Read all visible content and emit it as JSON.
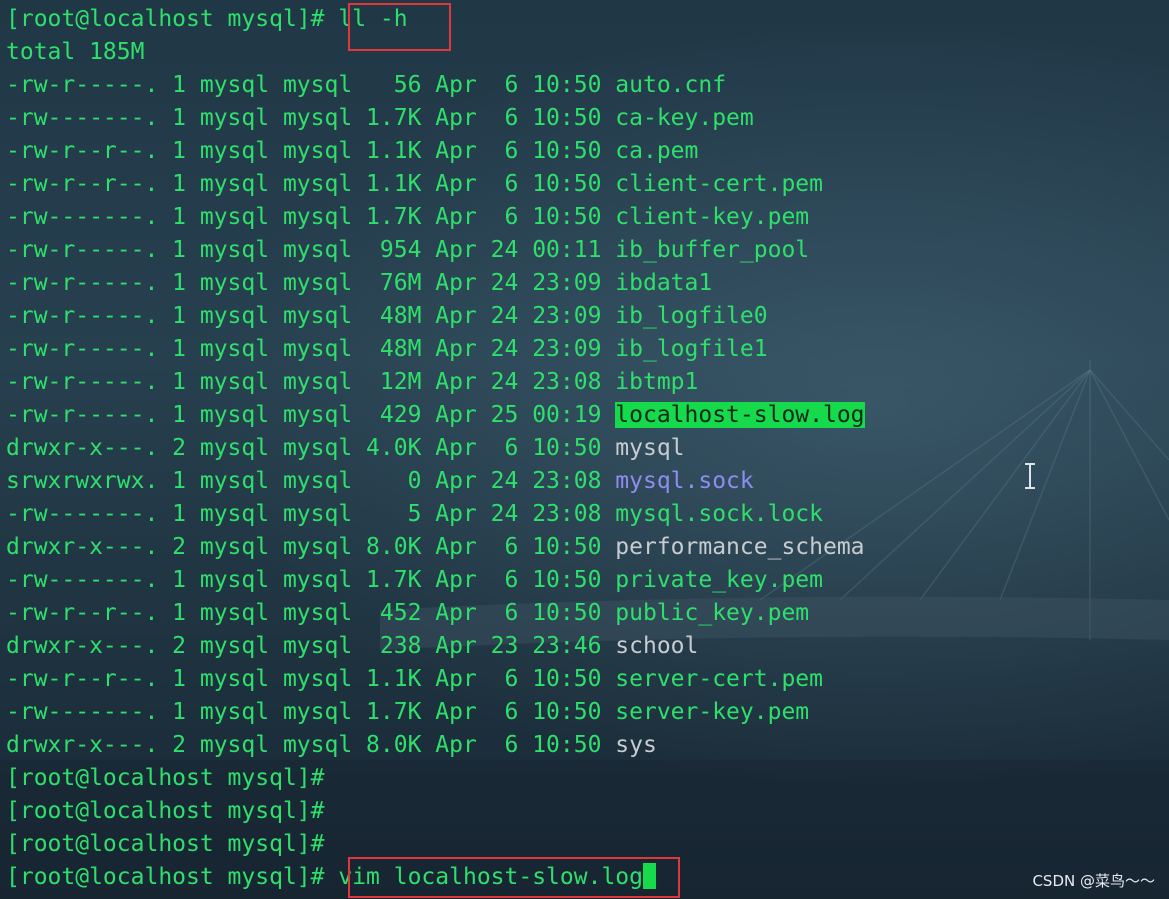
{
  "prompt": "[root@localhost mysql]# ",
  "command1": "ll -h",
  "total": "total 185M",
  "files": [
    {
      "perm": "-rw-r-----.",
      "links": "1",
      "owner": "mysql",
      "group": "mysql",
      "size": "56",
      "month": "Apr",
      "day": "6",
      "time": "10:50",
      "name": "auto.cnf",
      "kind": "file"
    },
    {
      "perm": "-rw-------.",
      "links": "1",
      "owner": "mysql",
      "group": "mysql",
      "size": "1.7K",
      "month": "Apr",
      "day": "6",
      "time": "10:50",
      "name": "ca-key.pem",
      "kind": "file"
    },
    {
      "perm": "-rw-r--r--.",
      "links": "1",
      "owner": "mysql",
      "group": "mysql",
      "size": "1.1K",
      "month": "Apr",
      "day": "6",
      "time": "10:50",
      "name": "ca.pem",
      "kind": "file"
    },
    {
      "perm": "-rw-r--r--.",
      "links": "1",
      "owner": "mysql",
      "group": "mysql",
      "size": "1.1K",
      "month": "Apr",
      "day": "6",
      "time": "10:50",
      "name": "client-cert.pem",
      "kind": "file"
    },
    {
      "perm": "-rw-------.",
      "links": "1",
      "owner": "mysql",
      "group": "mysql",
      "size": "1.7K",
      "month": "Apr",
      "day": "6",
      "time": "10:50",
      "name": "client-key.pem",
      "kind": "file"
    },
    {
      "perm": "-rw-r-----.",
      "links": "1",
      "owner": "mysql",
      "group": "mysql",
      "size": "954",
      "month": "Apr",
      "day": "24",
      "time": "00:11",
      "name": "ib_buffer_pool",
      "kind": "file"
    },
    {
      "perm": "-rw-r-----.",
      "links": "1",
      "owner": "mysql",
      "group": "mysql",
      "size": "76M",
      "month": "Apr",
      "day": "24",
      "time": "23:09",
      "name": "ibdata1",
      "kind": "file"
    },
    {
      "perm": "-rw-r-----.",
      "links": "1",
      "owner": "mysql",
      "group": "mysql",
      "size": "48M",
      "month": "Apr",
      "day": "24",
      "time": "23:09",
      "name": "ib_logfile0",
      "kind": "file"
    },
    {
      "perm": "-rw-r-----.",
      "links": "1",
      "owner": "mysql",
      "group": "mysql",
      "size": "48M",
      "month": "Apr",
      "day": "24",
      "time": "23:09",
      "name": "ib_logfile1",
      "kind": "file"
    },
    {
      "perm": "-rw-r-----.",
      "links": "1",
      "owner": "mysql",
      "group": "mysql",
      "size": "12M",
      "month": "Apr",
      "day": "24",
      "time": "23:08",
      "name": "ibtmp1",
      "kind": "file"
    },
    {
      "perm": "-rw-r-----.",
      "links": "1",
      "owner": "mysql",
      "group": "mysql",
      "size": "429",
      "month": "Apr",
      "day": "25",
      "time": "00:19",
      "name": "localhost-slow.log",
      "kind": "highlight"
    },
    {
      "perm": "drwxr-x---.",
      "links": "2",
      "owner": "mysql",
      "group": "mysql",
      "size": "4.0K",
      "month": "Apr",
      "day": "6",
      "time": "10:50",
      "name": "mysql",
      "kind": "dir"
    },
    {
      "perm": "srwxrwxrwx.",
      "links": "1",
      "owner": "mysql",
      "group": "mysql",
      "size": "0",
      "month": "Apr",
      "day": "24",
      "time": "23:08",
      "name": "mysql.sock",
      "kind": "sock"
    },
    {
      "perm": "-rw-------.",
      "links": "1",
      "owner": "mysql",
      "group": "mysql",
      "size": "5",
      "month": "Apr",
      "day": "24",
      "time": "23:08",
      "name": "mysql.sock.lock",
      "kind": "file"
    },
    {
      "perm": "drwxr-x---.",
      "links": "2",
      "owner": "mysql",
      "group": "mysql",
      "size": "8.0K",
      "month": "Apr",
      "day": "6",
      "time": "10:50",
      "name": "performance_schema",
      "kind": "dir"
    },
    {
      "perm": "-rw-------.",
      "links": "1",
      "owner": "mysql",
      "group": "mysql",
      "size": "1.7K",
      "month": "Apr",
      "day": "6",
      "time": "10:50",
      "name": "private_key.pem",
      "kind": "file"
    },
    {
      "perm": "-rw-r--r--.",
      "links": "1",
      "owner": "mysql",
      "group": "mysql",
      "size": "452",
      "month": "Apr",
      "day": "6",
      "time": "10:50",
      "name": "public_key.pem",
      "kind": "file"
    },
    {
      "perm": "drwxr-x---.",
      "links": "2",
      "owner": "mysql",
      "group": "mysql",
      "size": "238",
      "month": "Apr",
      "day": "23",
      "time": "23:46",
      "name": "school",
      "kind": "dir"
    },
    {
      "perm": "-rw-r--r--.",
      "links": "1",
      "owner": "mysql",
      "group": "mysql",
      "size": "1.1K",
      "month": "Apr",
      "day": "6",
      "time": "10:50",
      "name": "server-cert.pem",
      "kind": "file"
    },
    {
      "perm": "-rw-------.",
      "links": "1",
      "owner": "mysql",
      "group": "mysql",
      "size": "1.7K",
      "month": "Apr",
      "day": "6",
      "time": "10:50",
      "name": "server-key.pem",
      "kind": "file"
    },
    {
      "perm": "drwxr-x---.",
      "links": "2",
      "owner": "mysql",
      "group": "mysql",
      "size": "8.0K",
      "month": "Apr",
      "day": "6",
      "time": "10:50",
      "name": "sys",
      "kind": "dir"
    }
  ],
  "empty_prompts": 3,
  "command2": "vim localhost-slow.log",
  "watermark": "CSDN @菜鸟～～",
  "colors": {
    "text": "#2ee06b",
    "directory": "#c8ccd0",
    "socket": "#8f8cf2",
    "highlight": "#16d94c",
    "annotation_box": "#e0383a"
  },
  "icons": [
    "text-cursor-ibeam-icon"
  ]
}
